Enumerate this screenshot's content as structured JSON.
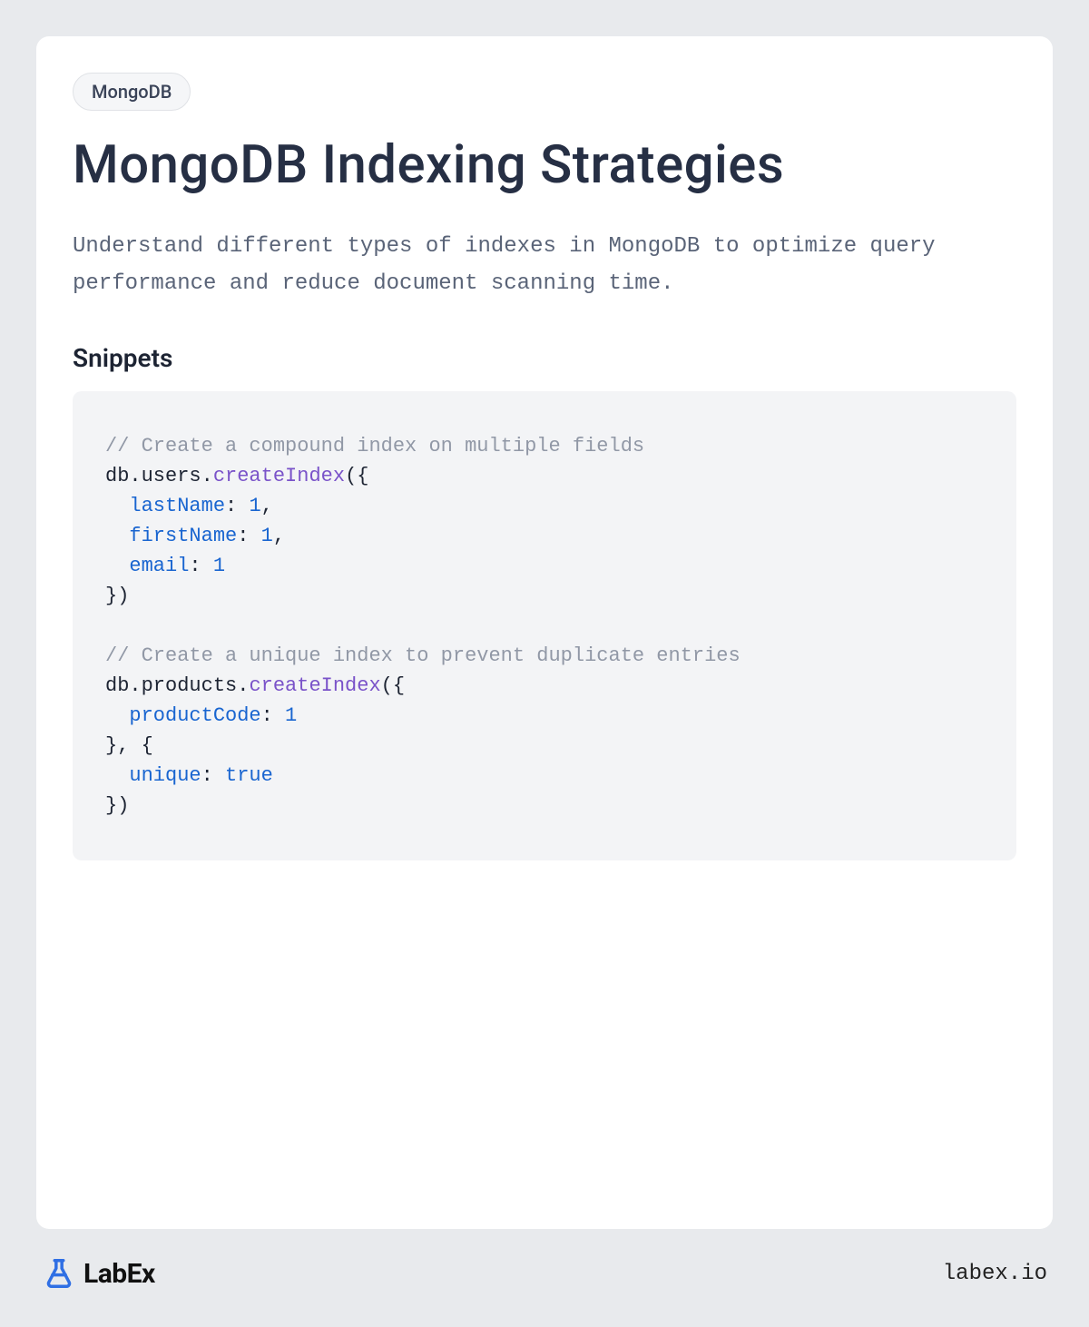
{
  "tag": "MongoDB",
  "title": "MongoDB Indexing Strategies",
  "description": "Understand different types of indexes in MongoDB to optimize query performance and reduce document scanning time.",
  "section_heading": "Snippets",
  "code": {
    "comment1": "// Create a compound index on multiple fields",
    "line2_pre": "db.users.",
    "line2_fn": "createIndex",
    "line2_post": "({",
    "k_lastName": "lastName",
    "v_lastName": "1",
    "k_firstName": "firstName",
    "v_firstName": "1",
    "k_email": "email",
    "v_email": "1",
    "close1": "})",
    "comment2": "// Create a unique index to prevent duplicate entries",
    "line9_pre": "db.products.",
    "line9_fn": "createIndex",
    "line9_post": "({",
    "k_productCode": "productCode",
    "v_productCode": "1",
    "mid": "}, {",
    "k_unique": "unique",
    "v_unique": "true",
    "close2": "})"
  },
  "brand": "LabEx",
  "site": "labex.io"
}
